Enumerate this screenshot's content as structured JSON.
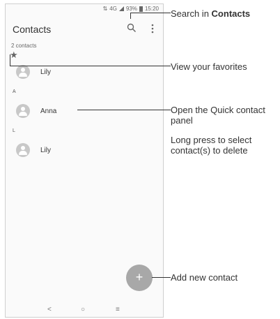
{
  "status": {
    "network": "4G",
    "battery": "93%",
    "time": "15:20"
  },
  "app": {
    "title": "Contacts",
    "count": "2 contacts"
  },
  "favorites": [
    {
      "name": "Lily"
    }
  ],
  "sections": [
    {
      "letter": "A",
      "contacts": [
        {
          "name": "Anna"
        }
      ]
    },
    {
      "letter": "L",
      "contacts": [
        {
          "name": "Lily"
        }
      ]
    }
  ],
  "fab_label": "+",
  "nav": {
    "back": "<",
    "home": "○",
    "recents": "≡"
  },
  "callouts": {
    "search_prefix": "Search in ",
    "search_bold": "Contacts",
    "favorites": "View your favorites",
    "quick_contact": "Open the Quick contact panel",
    "long_press": "Long press to select contact(s) to delete",
    "add": "Add new contact"
  },
  "colors": {
    "fab": "#a8a8a8",
    "avatar": "#c8c8c8"
  }
}
